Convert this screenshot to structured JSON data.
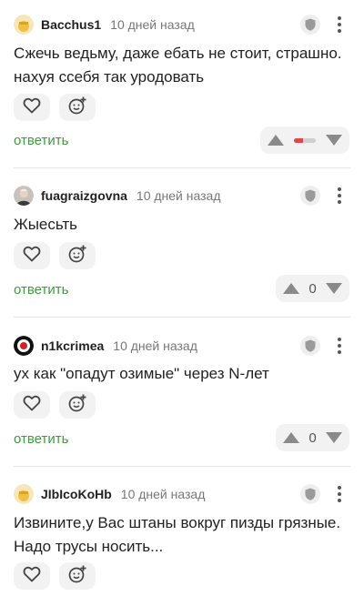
{
  "colors": {
    "accent": "#3c9c3c",
    "negative": "#e0474c"
  },
  "icons": {
    "like": "heart-icon",
    "react": "emoji-plus-icon",
    "badge": "shield-icon",
    "menu": "kebab-menu-icon",
    "up": "arrow-up-icon",
    "down": "arrow-down-icon"
  },
  "comments": [
    {
      "author": "Bacchus1",
      "time": "10 дней назад",
      "text": "Сжечь ведьму, даже ебать не стоит, страшно. нахуя ссебя так уродовать",
      "reply_label": "ответить",
      "rating_negative_share": 0.4
    },
    {
      "author": "fuagraizgovna",
      "time": "10 дней назад",
      "text": "Жыесьть",
      "reply_label": "ответить",
      "score": "0"
    },
    {
      "author": "n1kcrimea",
      "time": "10 дней назад",
      "text": "ух как \"опадут озимые\" через N-лет",
      "reply_label": "ответить",
      "score": "0"
    },
    {
      "author": "JIbIcoKoHb",
      "time": "10 дней назад",
      "text": "Извините,у Вас штаны вокруг пизды грязные. Надо трусы носить..."
    }
  ]
}
